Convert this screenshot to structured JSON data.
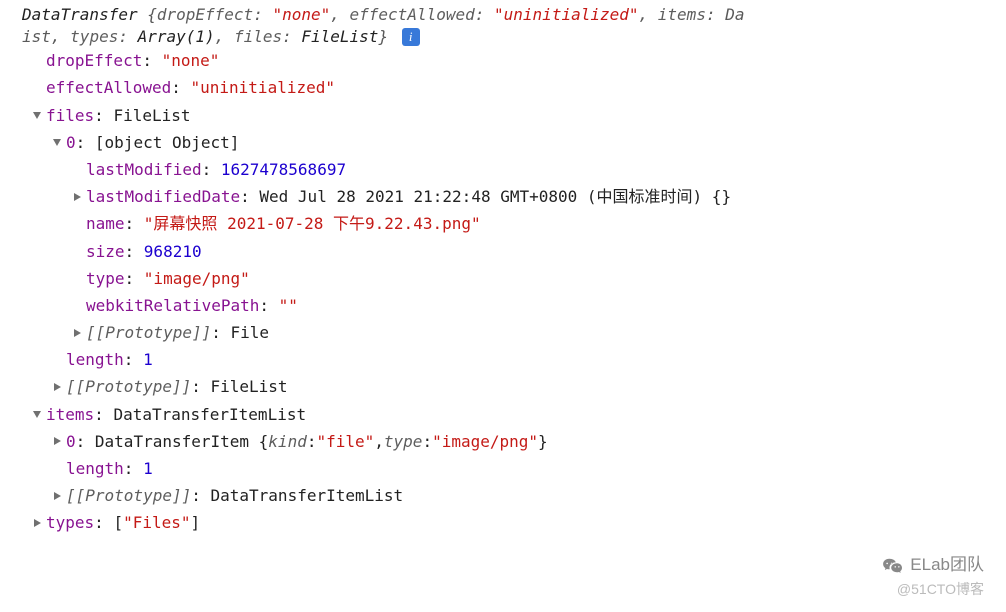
{
  "summary": {
    "class": "DataTransfer",
    "parts": [
      {
        "key": "dropEffect",
        "val": "\"none\"",
        "cls": "str"
      },
      {
        "key": "effectAllowed",
        "val": "\"uninitialized\"",
        "cls": "str"
      },
      {
        "key": "items",
        "val": "DataTransferItemList",
        "cls": "obj",
        "wrap": true
      },
      {
        "key": "types",
        "val": "Array(1)",
        "cls": "obj"
      },
      {
        "key": "files",
        "val": "FileList",
        "cls": "obj"
      }
    ]
  },
  "props": {
    "dropEffect": {
      "key": "dropEffect",
      "val": "\"none\""
    },
    "effectAllowed": {
      "key": "effectAllowed",
      "val": "\"uninitialized\""
    },
    "files": {
      "key": "files",
      "type": "FileList",
      "item0": {
        "key": "0",
        "type": {
          "key": "type",
          "val": "\"image/png\""
        },
        "lastModified": {
          "key": "lastModified",
          "val": "1627478568697"
        },
        "lastModifiedDate": {
          "key": "lastModifiedDate",
          "val": "Wed Jul 28 2021 21:22:48 GMT+0800 (中国标准时间) {}"
        },
        "name": {
          "key": "name",
          "val": "\"屏幕快照 2021-07-28 下午9.22.43.png\""
        },
        "size": {
          "key": "size",
          "val": "968210"
        },
        "webkitRelativePath": {
          "key": "webkitRelativePath",
          "val": "\"\""
        },
        "proto": {
          "key": "[[Prototype]]",
          "val": "File"
        }
      },
      "length": {
        "key": "length",
        "val": "1"
      },
      "proto": {
        "key": "[[Prototype]]",
        "val": "FileList"
      }
    },
    "items": {
      "key": "items",
      "type": "DataTransferItemList",
      "item0": {
        "key": "0",
        "type": "DataTransferItem",
        "kind": {
          "key": "kind",
          "val": "\"file\""
        },
        "typek": {
          "key": "type",
          "val": "\"image/png\""
        }
      },
      "length": {
        "key": "length",
        "val": "1"
      },
      "proto": {
        "key": "[[Prototype]]",
        "val": "DataTransferItemList"
      }
    },
    "types": {
      "key": "types",
      "val": "[\"Files\"]",
      "inner": "\"Files\""
    }
  },
  "watermark": {
    "line1": "ELab团队",
    "line2": "@51CTO博客"
  },
  "info": "i"
}
